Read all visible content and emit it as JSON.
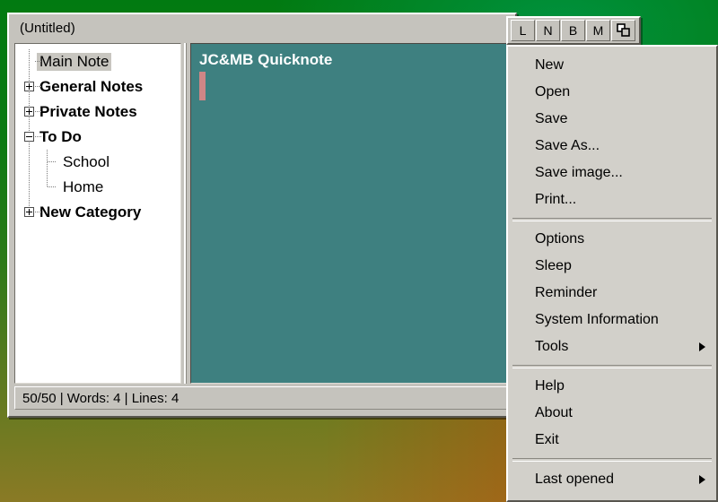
{
  "window": {
    "title": "(Untitled)"
  },
  "tree": {
    "items": [
      {
        "label": "Main Note",
        "level": 0,
        "toggle": "none",
        "bold": false,
        "selected": true,
        "last": false
      },
      {
        "label": "General Notes",
        "level": 0,
        "toggle": "plus",
        "bold": true,
        "selected": false,
        "last": false
      },
      {
        "label": "Private Notes",
        "level": 0,
        "toggle": "plus",
        "bold": true,
        "selected": false,
        "last": false
      },
      {
        "label": "To Do",
        "level": 0,
        "toggle": "minus",
        "bold": true,
        "selected": false,
        "last": false
      },
      {
        "label": "School",
        "level": 1,
        "toggle": "none",
        "bold": false,
        "selected": false,
        "last": false
      },
      {
        "label": "Home",
        "level": 1,
        "toggle": "none",
        "bold": false,
        "selected": false,
        "last": true
      },
      {
        "label": "New Category",
        "level": 0,
        "toggle": "plus",
        "bold": true,
        "selected": false,
        "last": true
      }
    ]
  },
  "editor": {
    "content": "JC&MB Quicknote",
    "background_color": "#3e8080",
    "text_color": "#ffffff",
    "caret_color": "#d08686"
  },
  "status_bar": {
    "text": "50/50  |  Words: 4  |  Lines: 4"
  },
  "toolbar": {
    "buttons": [
      {
        "label": "L",
        "name": "toolbar-button-l"
      },
      {
        "label": "N",
        "name": "toolbar-button-n"
      },
      {
        "label": "B",
        "name": "toolbar-button-b"
      },
      {
        "label": "M",
        "name": "toolbar-button-m"
      }
    ],
    "window_icon_button": "tile-windows-icon"
  },
  "menu": {
    "groups": [
      {
        "items": [
          {
            "label": "New",
            "submenu": false
          },
          {
            "label": "Open",
            "submenu": false
          },
          {
            "label": "Save",
            "submenu": false
          },
          {
            "label": "Save As...",
            "submenu": false
          },
          {
            "label": "Save image...",
            "submenu": false
          },
          {
            "label": "Print...",
            "submenu": false
          }
        ]
      },
      {
        "items": [
          {
            "label": "Options",
            "submenu": false
          },
          {
            "label": "Sleep",
            "submenu": false
          },
          {
            "label": "Reminder",
            "submenu": false
          },
          {
            "label": "System Information",
            "submenu": false
          },
          {
            "label": "Tools",
            "submenu": true
          }
        ]
      },
      {
        "items": [
          {
            "label": "Help",
            "submenu": false
          },
          {
            "label": "About",
            "submenu": false
          },
          {
            "label": "Exit",
            "submenu": false
          }
        ]
      },
      {
        "items": [
          {
            "label": "Last opened",
            "submenu": true
          }
        ]
      }
    ]
  }
}
